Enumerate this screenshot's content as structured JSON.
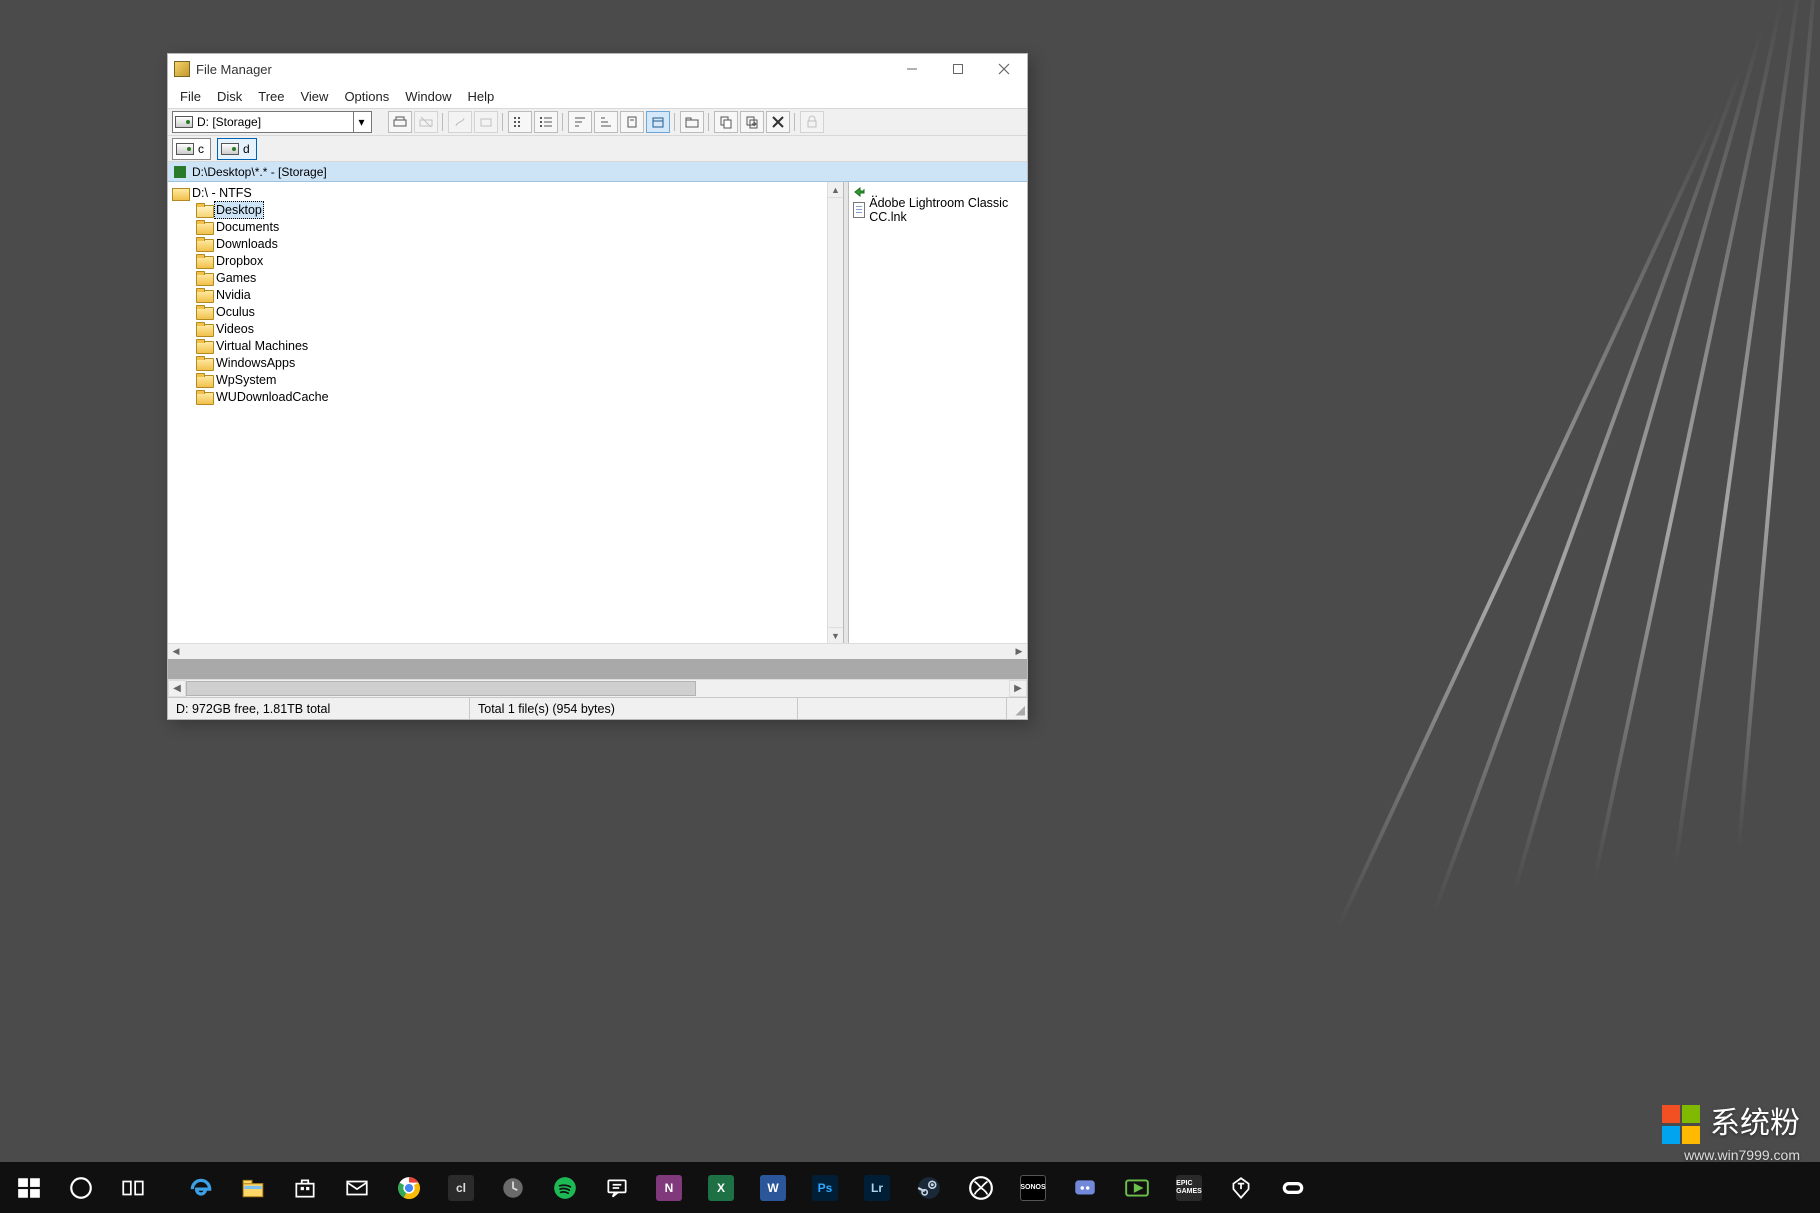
{
  "window": {
    "title": "File Manager"
  },
  "menu": {
    "items": [
      "File",
      "Disk",
      "Tree",
      "View",
      "Options",
      "Window",
      "Help"
    ]
  },
  "toolbar": {
    "drive_selected": "D: [Storage]"
  },
  "drives": {
    "tabs": [
      {
        "letter": "c",
        "active": false
      },
      {
        "letter": "d",
        "active": true
      }
    ]
  },
  "doc": {
    "title": "D:\\Desktop\\*.* - [Storage]"
  },
  "tree": {
    "root": "D:\\ - NTFS",
    "selected": "Desktop",
    "folders": [
      "Desktop",
      "Documents",
      "Downloads",
      "Dropbox",
      "Games",
      "Nvidia",
      "Oculus",
      "Videos",
      "Virtual Machines",
      "WindowsApps",
      "WpSystem",
      "WUDownloadCache"
    ]
  },
  "files": {
    "up": "..",
    "items": [
      "Adobe Lightroom Classic CC.lnk"
    ]
  },
  "status": {
    "left": "D: 972GB free,  1.81TB total",
    "mid": "Total 1 file(s) (954 bytes)"
  },
  "watermark": {
    "brand": "系统粉",
    "url": "www.win7999.com"
  }
}
